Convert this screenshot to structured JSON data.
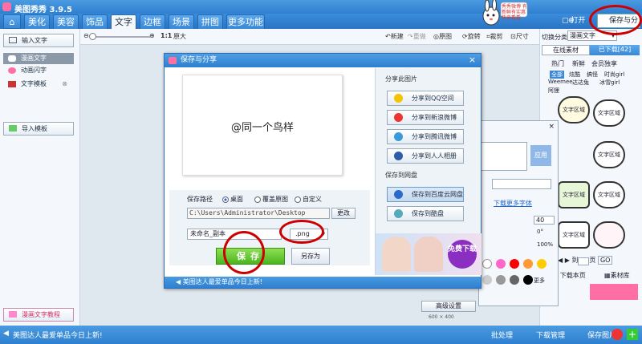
{
  "app": {
    "title": "美图秀秀 3.9.5"
  },
  "tabs": [
    "美化",
    "美容",
    "饰品",
    "文字",
    "边框",
    "场景",
    "拼图",
    "更多功能"
  ],
  "active_tab": "文字",
  "header": {
    "open": "打开",
    "new": "新建",
    "save_share": "保存与分享",
    "bunny_banner": "秀秀微博 有新鲜有实惠 快来看看"
  },
  "toolbar": {
    "zoom_ratio": "1:1",
    "original_size": "原大",
    "new": "新建",
    "redo": "重做",
    "original": "原图",
    "rotate": "旋转",
    "crop": "裁剪",
    "size": "尺寸"
  },
  "left_panel": {
    "input_text": "输入文字",
    "items": [
      {
        "label": "漫画文字",
        "selected": true
      },
      {
        "label": "动画闪字",
        "selected": false
      },
      {
        "label": "文字模板",
        "selected": false
      }
    ],
    "import_template": "导入模板",
    "tutorial": "漫画文字教程"
  },
  "right_panel": {
    "category_label": "切换分类",
    "category_value": "漫画文字",
    "tab_online": "在线素材",
    "tab_downloaded": "已下载[42]",
    "subtabs": [
      "热门",
      "新鲜",
      "会员独享"
    ],
    "tags": [
      "全部",
      "炫酷",
      "搞怪",
      "时尚girl",
      "Weemee",
      "达达兔",
      "冰雪girl",
      "阿狸"
    ],
    "thumb_label": "文字区域",
    "page_of": "页",
    "page_go": "GO",
    "download_this_page": "下载本页",
    "material_lib": "素材库"
  },
  "dialog": {
    "title": "保存与分享",
    "preview_text": "@同一个鸟样",
    "save_path_label": "保存路径",
    "path_options": [
      "桌面",
      "覆盖原图",
      "自定义"
    ],
    "path_selected": "桌面",
    "path_value": "C:\\Users\\Administrator\\Desktop",
    "change_button": "更改",
    "file_name": "未命名_副本",
    "extension": ".png",
    "save_button": "保存",
    "save_as_button": "另存为",
    "status": "美图达人最爱单品今日上新!",
    "share_heading": "分享此图片",
    "share_buttons": [
      "分享到QQ空间",
      "分享到新浪微博",
      "分享到腾讯微博",
      "分享到人人相册"
    ],
    "cloud_heading": "保存到网盘",
    "cloud_buttons": [
      "保存到百度云网盘",
      "保存到酷盘"
    ],
    "ad_badge": "免费下载"
  },
  "text_panel": {
    "apply": "应用",
    "download_font": "下载更多字体",
    "font_size": "40",
    "rotation": "0°",
    "opacity": "100%",
    "more": "更多",
    "advanced": "高级设置",
    "size_readout": "600 × 400"
  },
  "bottom_bar": {
    "message": "美图达人最爱单品今日上新!",
    "batch": "批处理",
    "download_manager": "下载管理",
    "save_image": "保存图片"
  },
  "colors": {
    "title_blue": "#2e7fd0",
    "save_green": "#4ab41e",
    "annotation_red": "#cc0000",
    "palette": [
      "#ffffff",
      "#ff66cc",
      "#ff0000",
      "#ff9933",
      "#ffcc00",
      "#ffff33",
      "#cccccc",
      "#999999",
      "#666666",
      "#000000"
    ]
  }
}
